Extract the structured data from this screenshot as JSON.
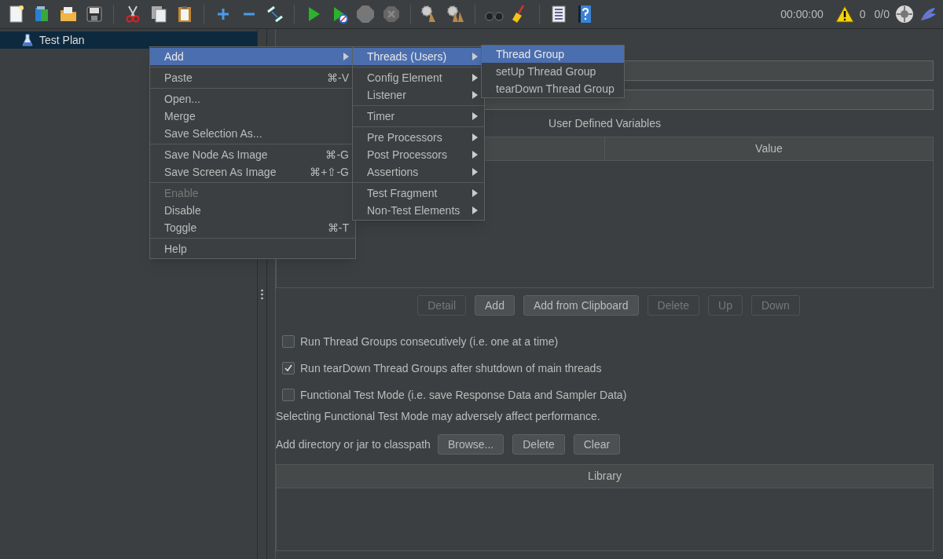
{
  "toolbar": {
    "timer": "00:00:00",
    "warning_count": "0",
    "thread_count": "0/0"
  },
  "tree": {
    "items": [
      {
        "label": "Test Plan",
        "selected": true
      }
    ]
  },
  "context_menu": {
    "groups": [
      [
        {
          "label": "Add",
          "submenu": true,
          "disabled": false,
          "selected": true
        }
      ],
      [
        {
          "label": "Paste",
          "shortcut": "⌘-V",
          "submenu": false,
          "disabled": false,
          "selected": false
        }
      ],
      [
        {
          "label": "Open...",
          "submenu": false,
          "disabled": false,
          "selected": false
        },
        {
          "label": "Merge",
          "submenu": false,
          "disabled": false,
          "selected": false
        },
        {
          "label": "Save Selection As...",
          "submenu": false,
          "disabled": false,
          "selected": false
        }
      ],
      [
        {
          "label": "Save Node As Image",
          "shortcut": "⌘-G",
          "submenu": false,
          "disabled": false,
          "selected": false
        },
        {
          "label": "Save Screen As Image",
          "shortcut": "⌘+⇧-G",
          "submenu": false,
          "disabled": false,
          "selected": false
        }
      ],
      [
        {
          "label": "Enable",
          "submenu": false,
          "disabled": true,
          "selected": false
        },
        {
          "label": "Disable",
          "submenu": false,
          "disabled": false,
          "selected": false
        },
        {
          "label": "Toggle",
          "shortcut": "⌘-T",
          "submenu": false,
          "disabled": false,
          "selected": false
        }
      ],
      [
        {
          "label": "Help",
          "submenu": false,
          "disabled": false,
          "selected": false
        }
      ]
    ]
  },
  "add_submenu": {
    "groups": [
      [
        {
          "label": "Threads (Users)",
          "submenu": true,
          "selected": true
        }
      ],
      [
        {
          "label": "Config Element",
          "submenu": true,
          "selected": false
        },
        {
          "label": "Listener",
          "submenu": true,
          "selected": false
        }
      ],
      [
        {
          "label": "Timer",
          "submenu": true,
          "selected": false
        }
      ],
      [
        {
          "label": "Pre Processors",
          "submenu": true,
          "selected": false
        },
        {
          "label": "Post Processors",
          "submenu": true,
          "selected": false
        },
        {
          "label": "Assertions",
          "submenu": true,
          "selected": false
        }
      ],
      [
        {
          "label": "Test Fragment",
          "submenu": true,
          "selected": false
        },
        {
          "label": "Non-Test Elements",
          "submenu": true,
          "selected": false
        }
      ]
    ]
  },
  "threads_submenu": {
    "items": [
      {
        "label": "Thread Group",
        "selected": true
      },
      {
        "label": "setUp Thread Group",
        "selected": false
      },
      {
        "label": "tearDown Thread Group",
        "selected": false
      }
    ]
  },
  "test_plan": {
    "variables_title": "User Defined Variables",
    "columns": [
      {},
      {
        "label": "Value"
      }
    ],
    "buttons": [
      {
        "label": "Detail",
        "disabled": true
      },
      {
        "label": "Add",
        "disabled": false
      },
      {
        "label": "Add from Clipboard",
        "disabled": false
      },
      {
        "label": "Delete",
        "disabled": true
      },
      {
        "label": "Up",
        "disabled": true
      },
      {
        "label": "Down",
        "disabled": true
      }
    ],
    "checkboxes": [
      {
        "label": "Run Thread Groups consecutively (i.e. one at a time)",
        "checked": false
      },
      {
        "label": "Run tearDown Thread Groups after shutdown of main threads",
        "checked": true
      },
      {
        "label": "Functional Test Mode (i.e. save Response Data and Sampler Data)",
        "checked": false
      }
    ],
    "note": "Selecting Functional Test Mode may adversely affect performance.",
    "classpath_label": "Add directory or jar to classpath",
    "classpath_buttons": [
      {
        "label": "Browse..."
      },
      {
        "label": "Delete"
      },
      {
        "label": "Clear"
      }
    ],
    "library_column": "Library"
  }
}
